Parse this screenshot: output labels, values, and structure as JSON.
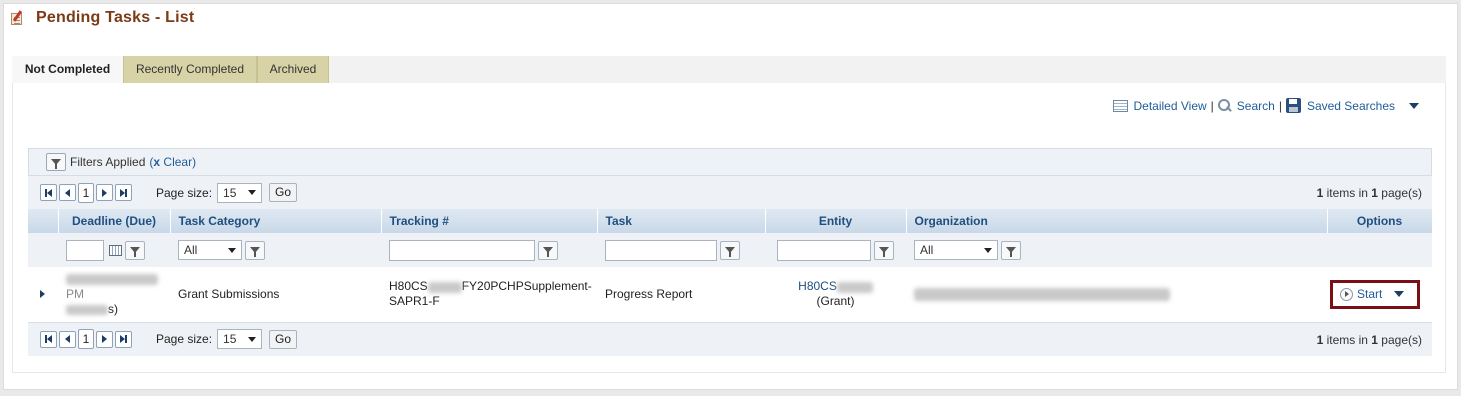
{
  "page": {
    "title": "Pending Tasks - List"
  },
  "tabs": [
    {
      "label": "Not Completed",
      "active": true
    },
    {
      "label": "Recently Completed",
      "active": false
    },
    {
      "label": "Archived",
      "active": false
    }
  ],
  "toolbar": {
    "detailed_view": "Detailed View",
    "search": "Search",
    "saved_searches": "Saved Searches",
    "separator": "|"
  },
  "filters": {
    "label": "Filters Applied",
    "clear_open": "(",
    "clear_x": "x",
    "clear_label": "Clear)"
  },
  "pager": {
    "current_page": "1",
    "page_size_label": "Page size:",
    "page_size": "15",
    "go_label": "Go",
    "items_count": "1",
    "items_text": " items in ",
    "pages_count": "1",
    "pages_text": " page(s)"
  },
  "columns": {
    "deadline": "Deadline (Due)",
    "task_category": "Task Category",
    "tracking": "Tracking #",
    "task": "Task",
    "entity": "Entity",
    "organization": "Organization",
    "options": "Options"
  },
  "filter_row": {
    "task_category_value": "All",
    "organization_value": "All"
  },
  "rows": [
    {
      "deadline_line2": "PM",
      "deadline_suffix": "s)",
      "task_category": "Grant Submissions",
      "tracking_prefix": "H80CS",
      "tracking_suffix": "FY20PCHPSupplement-",
      "tracking_line2": "SAPR1-F",
      "task": "Progress Report",
      "entity_prefix": "H80CS",
      "entity_line2": "(Grant)",
      "action_label": "Start"
    }
  ],
  "colors": {
    "title": "#7a3b15",
    "link": "#1f5d99",
    "header_text": "#1f4f80",
    "start_highlight": "#7a0f16",
    "inactive_tab": "#d7d3a7"
  }
}
